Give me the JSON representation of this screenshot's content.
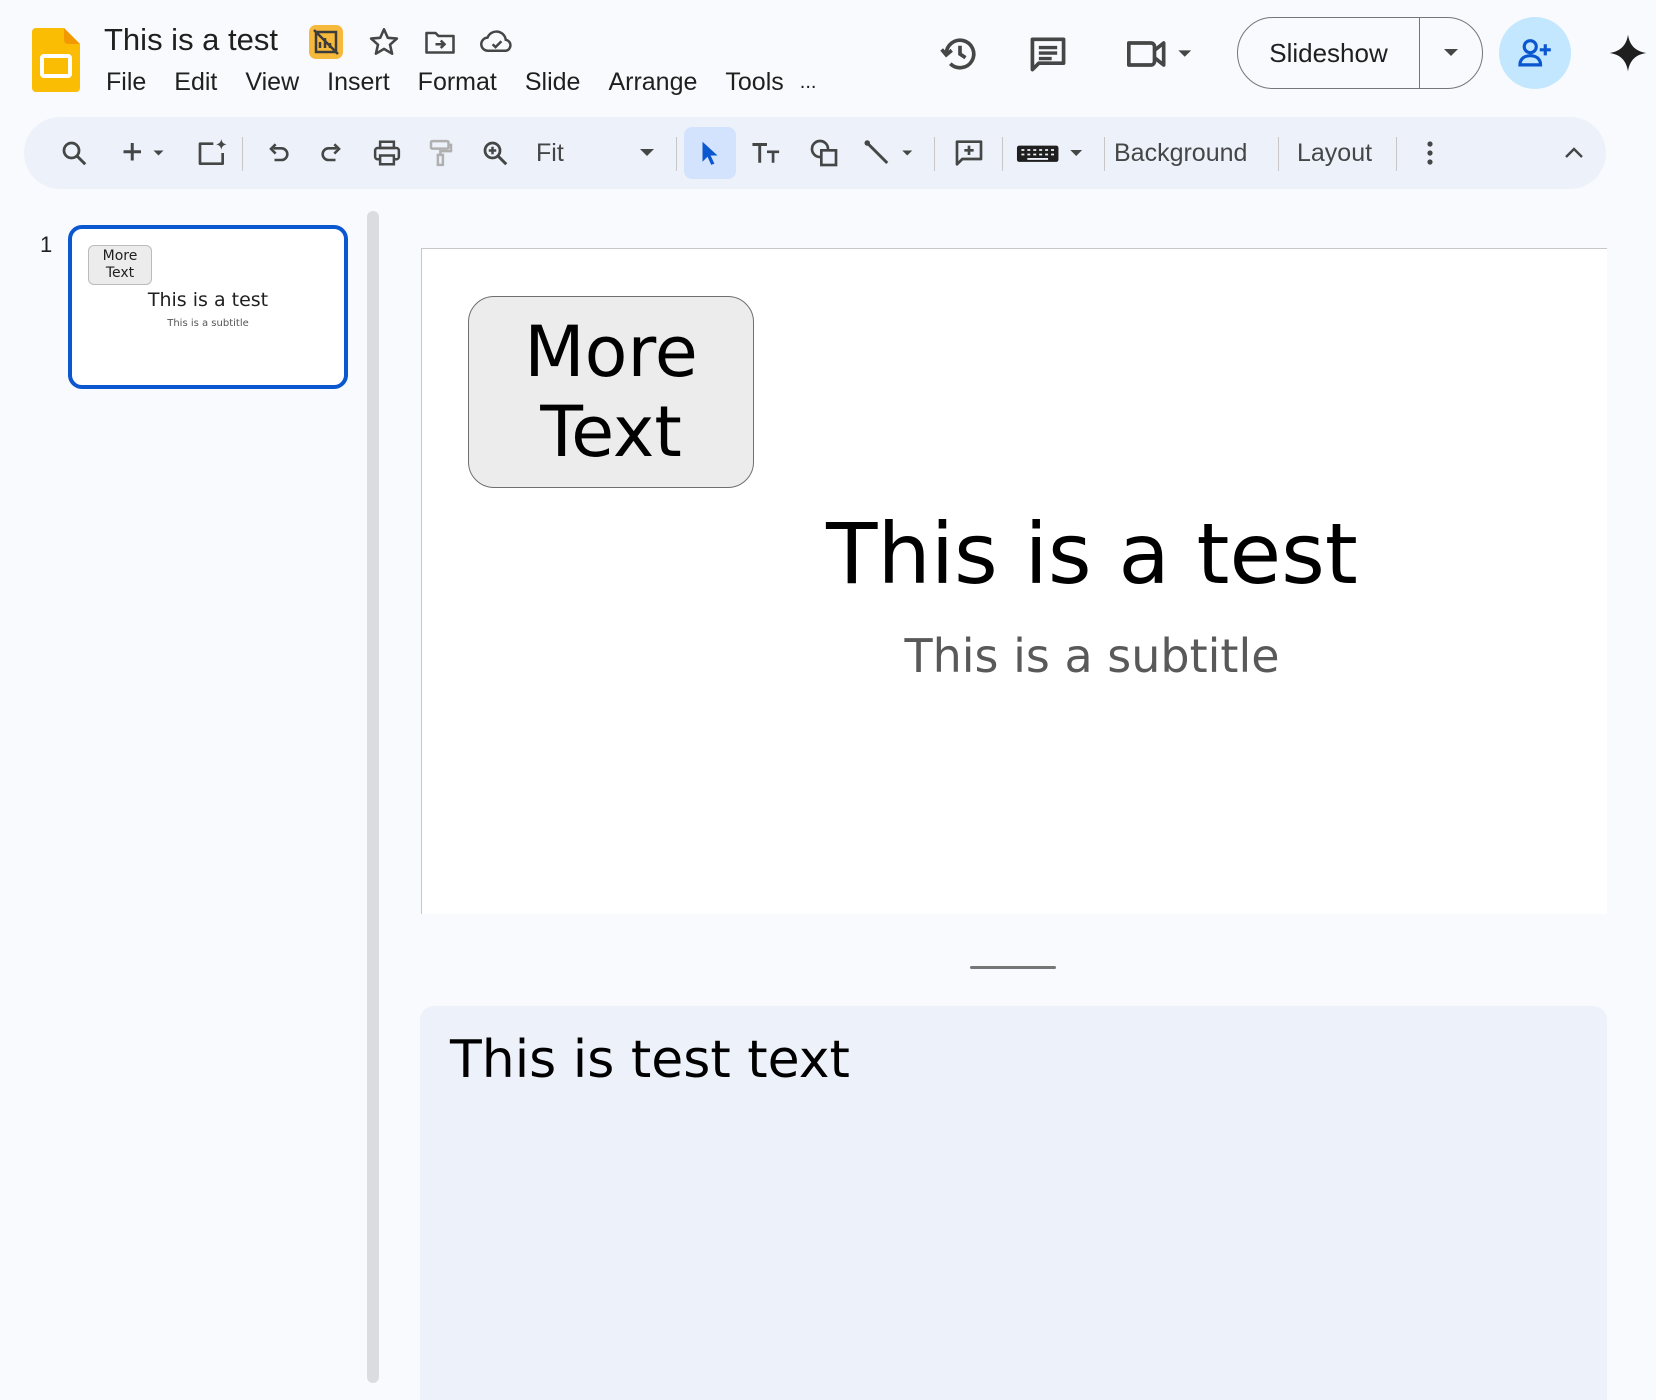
{
  "header": {
    "doc_title": "This is a test",
    "menu": [
      "File",
      "Edit",
      "View",
      "Insert",
      "Format",
      "Slide",
      "Arrange",
      "Tools",
      "..."
    ],
    "slideshow_label": "Slideshow",
    "brand_color": "#fbbc04"
  },
  "toolbar": {
    "zoom_value": "Fit",
    "background_label": "Background",
    "layout_label": "Layout",
    "accent": "#0b57d0"
  },
  "filmstrip": {
    "slides": [
      {
        "number": "1",
        "box_text": "More\nText",
        "title": "This is a test",
        "subtitle": "This is a subtitle"
      }
    ]
  },
  "slide": {
    "box_text": "More\nText",
    "title": "This is a test",
    "subtitle": "This is a subtitle"
  },
  "notes": {
    "text": "This is test text"
  }
}
